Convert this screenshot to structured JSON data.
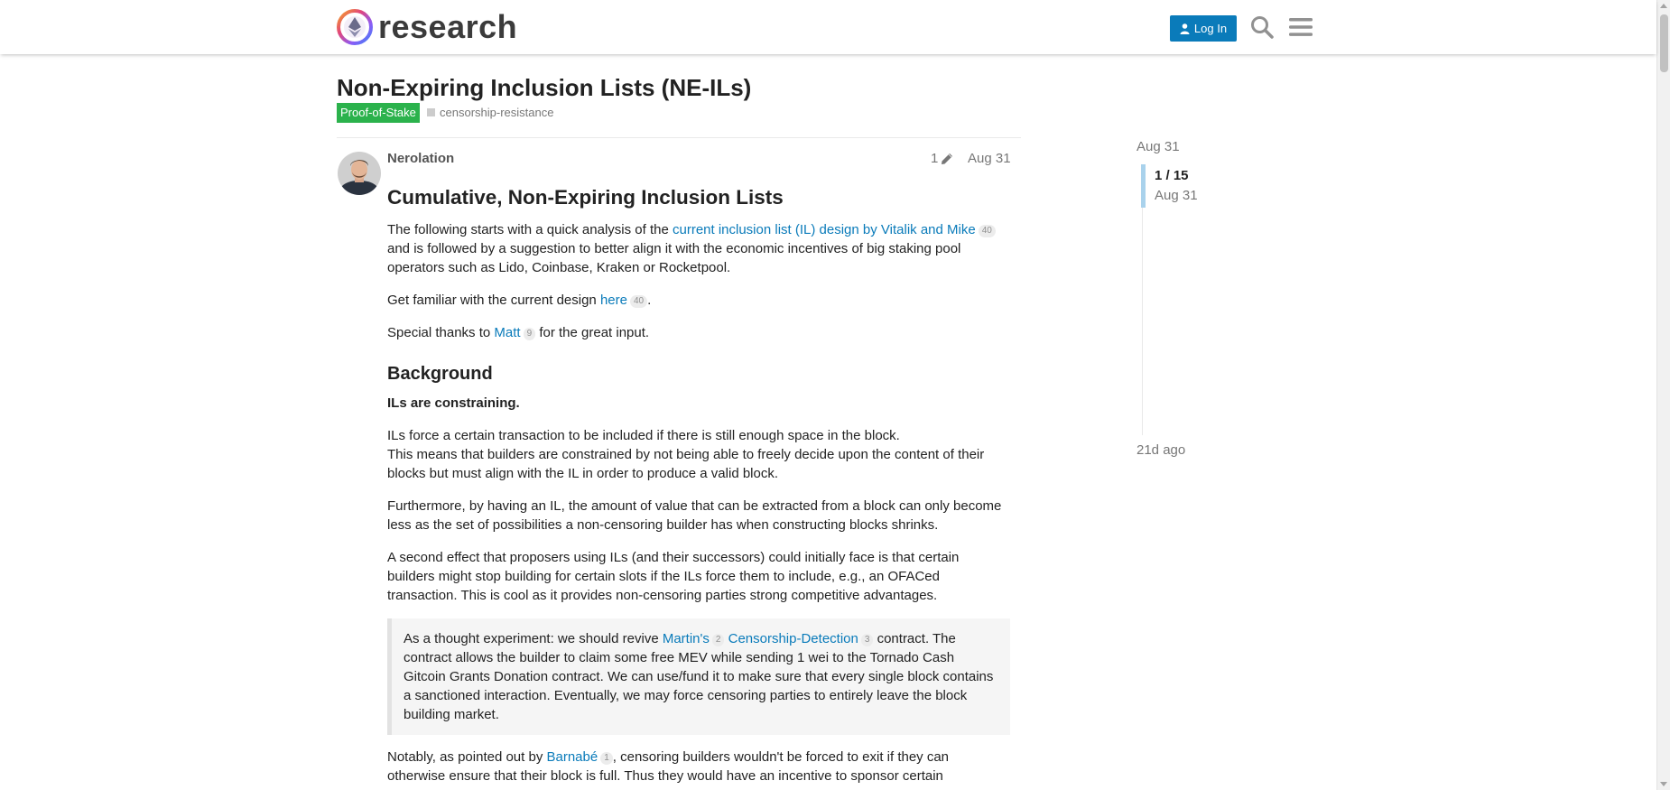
{
  "header": {
    "logo_text": "research",
    "login_label": "Log In",
    "icons": [
      "search-icon",
      "menu-icon"
    ],
    "accent_color": "#0a7bba"
  },
  "topic": {
    "title": "Non-Expiring Inclusion Lists (NE-ILs)",
    "category": "Proof-of-Stake",
    "category_color": "#2bb24c",
    "tag": "censorship-resistance"
  },
  "post": {
    "author": "Nerolation",
    "edit_count": "1",
    "date": "Aug 31",
    "heading": "Cumulative, Non-Expiring Inclusion Lists",
    "p1_before": "The following starts with a quick analysis of the ",
    "p1_link": "current inclusion list (IL) design by Vitalik and Mike",
    "p1_link_count": "40",
    "p1_after": " and is followed by a suggestion to better align it with the economic incentives of big staking pool operators such as Lido, Coinbase, Kraken or Rocketpool.",
    "p2_before": "Get familiar with the current design ",
    "p2_link": "here",
    "p2_link_count": "40",
    "p2_after": ".",
    "p3_before": "Special thanks to ",
    "p3_link": "Matt",
    "p3_link_count": "9",
    "p3_after": " for the great input.",
    "section_heading": "Background",
    "bold_line": "ILs are constraining.",
    "p4_line1": "ILs force a certain transaction to be included if there is still enough space in the block.",
    "p4_line2": "This means that builders are constrained by not being able to freely decide upon the content of their blocks but must align with the IL in order to produce a valid block.",
    "p5": "Furthermore, by having an IL, the amount of value that can be extracted from a block can only become less as the set of possibilities a non-censoring builder has when constructing blocks shrinks.",
    "p6": "A second effect that proposers using ILs (and their successors) could initially face is that certain builders might stop building for certain slots if the ILs force them to include, e.g., an OFACed transaction. This is cool as it provides non-censoring parties strong competitive advantages.",
    "quote_before": "As a thought experiment: we should revive ",
    "quote_link1": "Martin's",
    "quote_link1_count": "2",
    "quote_link2": "Censorship-Detection",
    "quote_link2_count": "3",
    "quote_after": " contract. The contract allows the builder to claim some free MEV while sending 1 wei to the Tornado Cash Gitcoin Grants Donation contract. We can use/fund it to make sure that every single block contains a sanctioned interaction. Eventually, we may force censoring parties to entirely leave the block building market.",
    "p7_before": "Notably, as pointed out by ",
    "p7_link": "Barnabé",
    "p7_link_count": "1",
    "p7_after": ", censoring builders wouldn't be forced to exit if they can otherwise ensure that their block is full. Thus they would have an incentive to sponsor certain"
  },
  "timeline": {
    "top_date": "Aug 31",
    "position": "1 / 15",
    "position_date": "Aug 31",
    "bottom_label": "21d ago"
  }
}
